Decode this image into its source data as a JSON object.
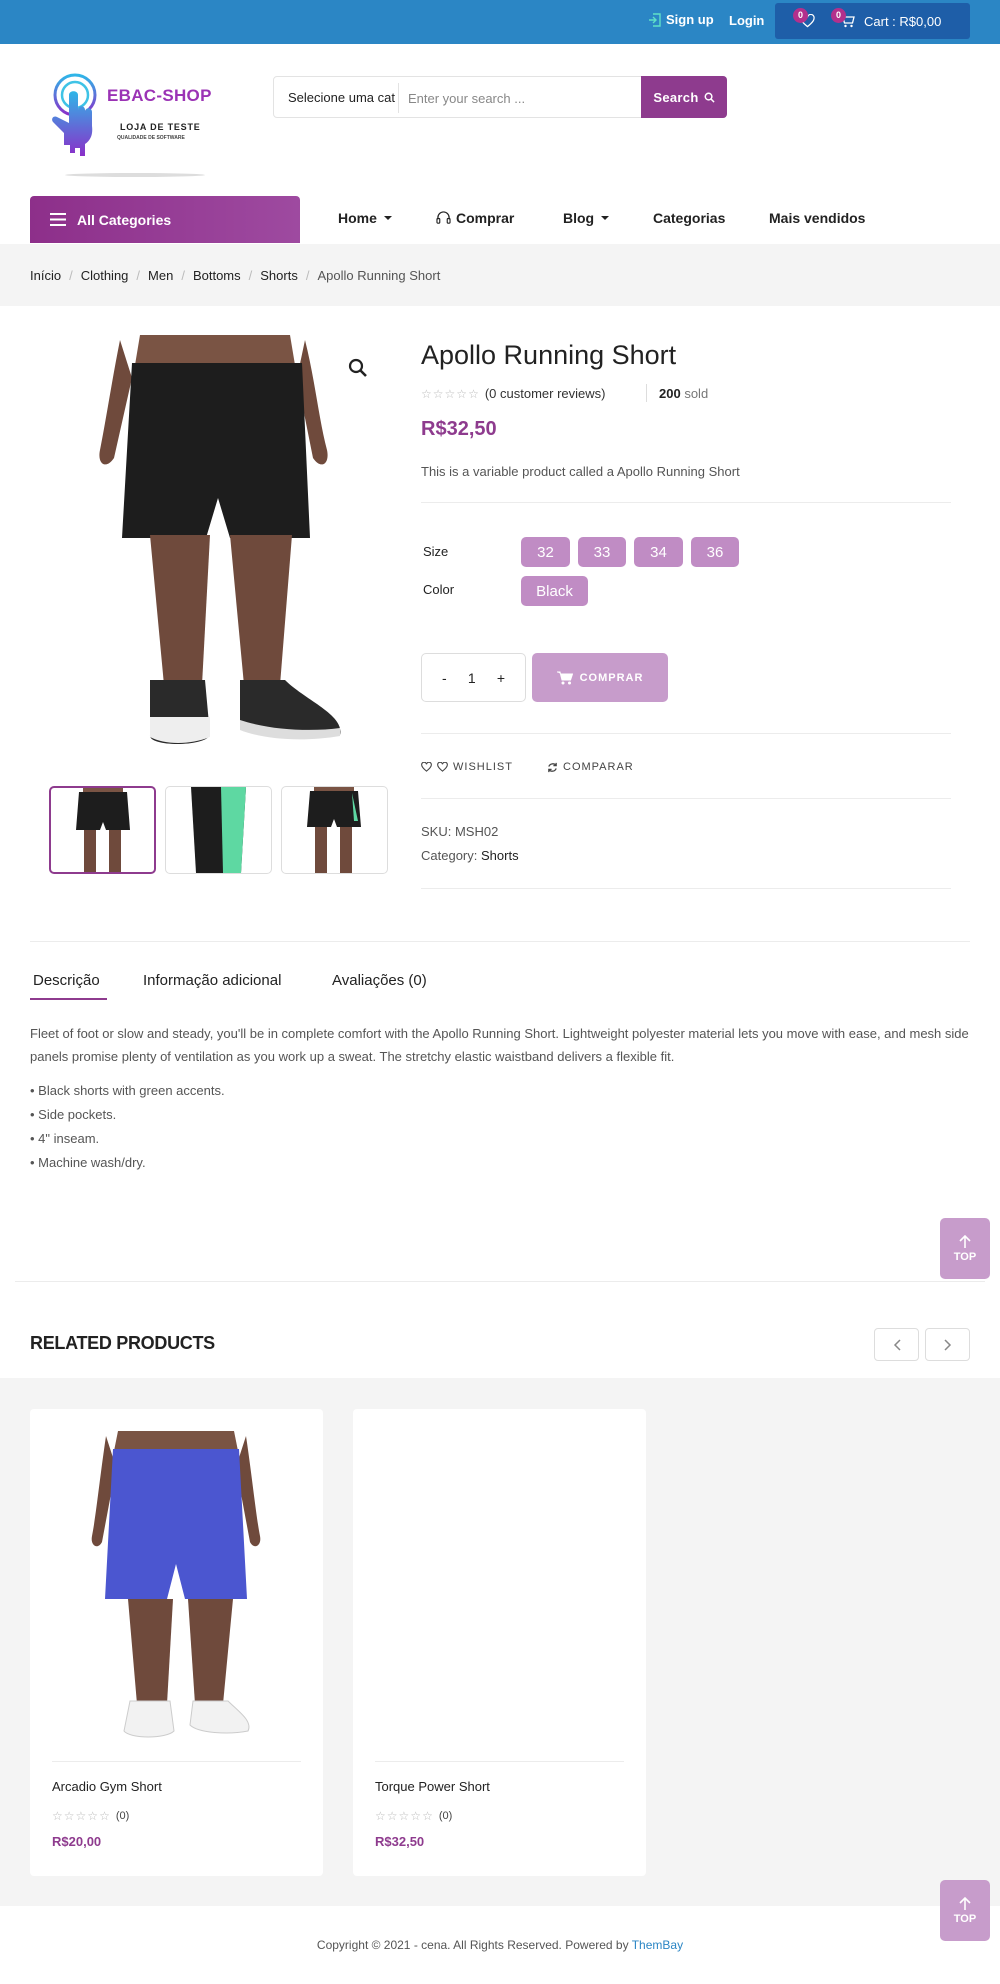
{
  "topbar": {
    "signup": "Sign up",
    "login": "Login",
    "wishlist_count": "0",
    "cart_count": "0",
    "cart_label": "Cart : R$0,00"
  },
  "logo": {
    "brand": "EBAC-SHOP",
    "line1": "LOJA DE TESTE",
    "line2": "QUALIDADE DE SOFTWARE"
  },
  "search": {
    "category": "Selecione uma cat",
    "placeholder": "Enter your search ...",
    "button": "Search"
  },
  "nav": {
    "all_categories": "All Categories",
    "items": [
      "Home",
      "Comprar",
      "Blog",
      "Categorias",
      "Mais vendidos"
    ]
  },
  "breadcrumb": [
    "Início",
    "Clothing",
    "Men",
    "Bottoms",
    "Shorts",
    "Apollo Running Short"
  ],
  "product": {
    "title": "Apollo Running Short",
    "reviews": "(0 customer reviews)",
    "sold_count": "200",
    "sold_label": "sold",
    "price": "R$32,50",
    "short_description": "This is a variable product called a Apollo Running Short",
    "size_label": "Size",
    "sizes": [
      "32",
      "33",
      "34",
      "36"
    ],
    "color_label": "Color",
    "colors": [
      "Black"
    ],
    "qty_minus": "-",
    "quantity": "1",
    "qty_plus": "+",
    "buy_button": "COMPRAR",
    "wishlist": "WISHLIST",
    "compare": "COMPARAR",
    "sku": "SKU: MSH02",
    "category_label": "Category:",
    "category": "Shorts"
  },
  "tabs": [
    "Descrição",
    "Informação adicional",
    "Avaliações (0)"
  ],
  "description": "Fleet of foot or slow and steady, you'll be in complete comfort with the Apollo Running Short. Lightweight polyester material lets you move with ease, and mesh side panels promise plenty of ventilation as you work up a sweat. The stretchy elastic waistband delivers a flexible fit.",
  "bullets": [
    "• Black shorts with green accents.",
    "• Side pockets.",
    "• 4\" inseam.",
    "• Machine wash/dry."
  ],
  "top_button": "TOP",
  "related": {
    "heading": "RELATED PRODUCTS",
    "products": [
      {
        "name": "Arcadio Gym Short",
        "reviews": "(0)",
        "price": "R$20,00"
      },
      {
        "name": "Torque Power Short",
        "reviews": "(0)",
        "price": "R$32,50"
      }
    ]
  },
  "footer": {
    "copyright": "Copyright © 2021 - cena. All Rights Reserved. Powered by",
    "powered_link": "ThemBay"
  },
  "colors": {
    "topbar": "#2b86c5",
    "accent": "#8e3b8e",
    "swatch": "#c08cc4"
  }
}
